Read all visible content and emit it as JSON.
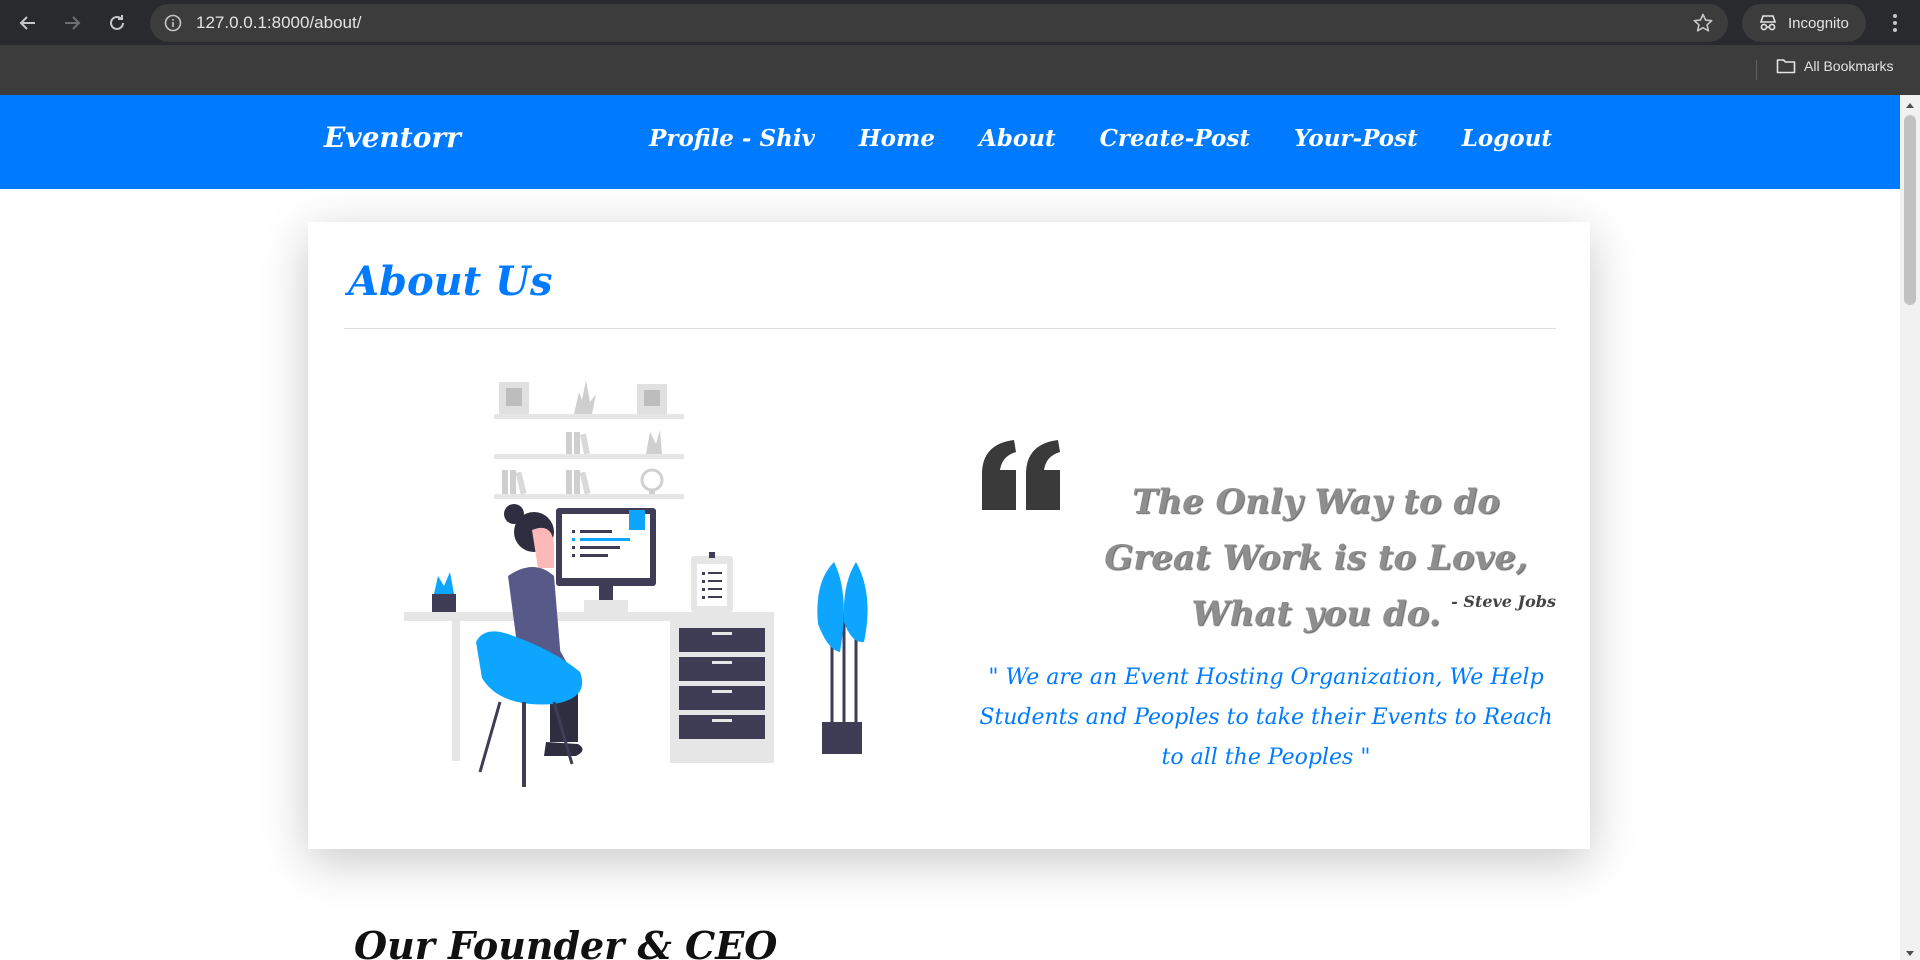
{
  "browser": {
    "url": "127.0.0.1:8000/about/",
    "profile_label": "Incognito",
    "bookmarks_label": "All Bookmarks"
  },
  "site": {
    "brand": "Eventorr",
    "nav": [
      {
        "label": "Profile - Shiv"
      },
      {
        "label": "Home"
      },
      {
        "label": "About"
      },
      {
        "label": "Create-Post"
      },
      {
        "label": "Your-Post"
      },
      {
        "label": "Logout"
      }
    ]
  },
  "about": {
    "title": "About Us",
    "quote": "The Only Way to do Great Work is to Love, What you do.",
    "quote_author": "- Steve Jobs",
    "mission": "\" We are an Event Hosting Organization, We Help Students and Peoples to take their Events to Reach to all the Peoples \""
  },
  "founder": {
    "title": "Our Founder & CEO"
  },
  "colors": {
    "brand_blue": "#007bff",
    "chrome_dark": "#292a2d",
    "quote_gray": "#8e8e8e",
    "illustration_dark": "#3f3d56",
    "illustration_blue": "#0ea5ff"
  }
}
